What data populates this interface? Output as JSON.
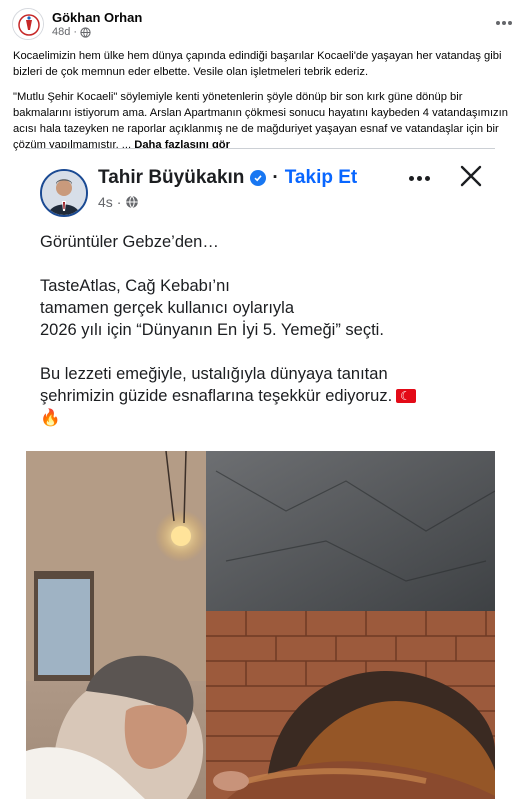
{
  "post": {
    "author": "Gökhan Orhan",
    "time": "48d",
    "more_icon": "more-horizontal-icon",
    "privacy_icon": "globe-icon",
    "paragraphs": [
      "Kocaelimizin hem ülke hem dünya çapında edindiği başarılar Kocaeli'de yaşayan her vatandaş gibi bizleri de çok memnun eder elbette. Vesile olan işletmeleri tebrik ederiz.",
      "\"Mutlu Şehir Kocaeli\" söylemiyle kenti yönetenlerin şöyle dönüp bir son kırk güne dönüp bir bakmalarını istiyorum ama.  Arslan Apartmanın çökmesi sonucu hayatını kaybeden 4 vatandaşımızın acısı hala tazeyken ne raporlar açıklanmış ne de mağduriyet yaşayan esnaf ve vatandaşlar için bir çözüm yapılmamıştır. ..."
    ],
    "see_more": "Daha fazlasını gör"
  },
  "embedded": {
    "author": "Tahir Büyükakın",
    "separator": "·",
    "follow": "Takip Et",
    "time": "4s",
    "lines_block1": [
      "Görüntüler Gebze’den…"
    ],
    "lines_block2": [
      "TasteAtlas, Cağ Kebabı’nı",
      "tamamen gerçek kullanıcı oylarıyla",
      "2026 yılı için “Dünyanın En İyi 5. Yemeği” seçti."
    ],
    "lines_block3": [
      "Bu lezzeti emeğiyle, ustalığıyla dünyaya tanıtan",
      "şehrimizin güzide esnaflarına teşekkür ediyoruz."
    ],
    "emoji_flag": "turkey-flag-icon",
    "emoji_fire": "🔥",
    "icons": {
      "verified": "verified-badge-icon",
      "privacy": "globe-icon",
      "more": "more-horizontal-icon",
      "close": "close-icon"
    }
  },
  "colors": {
    "link_blue": "#0866ff",
    "verified_blue": "#1877f2",
    "secondary_text": "#65676b"
  }
}
